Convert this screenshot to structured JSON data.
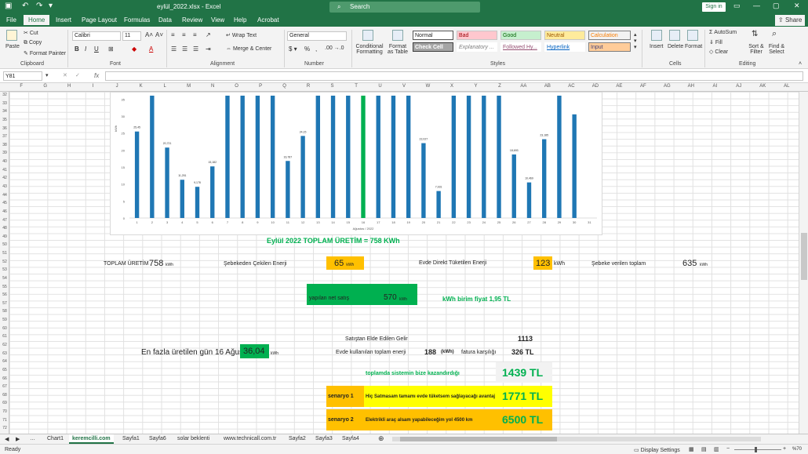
{
  "titlebar": {
    "file_name": "eylül_2022.xlsx",
    "sep": "-",
    "app": "Excel",
    "search": "Search",
    "signin": "Sign in"
  },
  "tabs": [
    "File",
    "Home",
    "Insert",
    "Page Layout",
    "Formulas",
    "Data",
    "Review",
    "View",
    "Help",
    "Acrobat"
  ],
  "share": "Share",
  "ribbon": {
    "clipboard": {
      "paste": "Paste",
      "cut": "Cut",
      "copy": "Copy",
      "format_painter": "Format Painter",
      "label": "Clipboard"
    },
    "font": {
      "name": "Calibri",
      "size": "11",
      "label": "Font"
    },
    "alignment": {
      "wrap": "Wrap Text",
      "merge": "Merge & Center",
      "label": "Alignment"
    },
    "number": {
      "format": "General",
      "label": "Number"
    },
    "styles": {
      "conditional": "Conditional Formatting",
      "format_table": "Format as Table",
      "normal": "Normal",
      "bad": "Bad",
      "good": "Good",
      "neutral": "Neutral",
      "calculation": "Calculation",
      "check_cell": "Check Cell",
      "explanatory": "Explanatory ...",
      "followed": "Followed Hy...",
      "hyperlink": "Hyperlink",
      "input": "Input",
      "label": "Styles"
    },
    "cells": {
      "insert": "Insert",
      "delete": "Delete",
      "format": "Format",
      "label": "Cells"
    },
    "editing": {
      "autosum": "AutoSum",
      "fill": "Fill",
      "clear": "Clear",
      "sort": "Sort & Filter",
      "find": "Find & Select",
      "label": "Editing"
    }
  },
  "namebox": "Y81",
  "fx": "fx",
  "columns": [
    "F",
    "G",
    "H",
    "I",
    "J",
    "K",
    "L",
    "M",
    "N",
    "O",
    "P",
    "Q",
    "R",
    "S",
    "T",
    "U",
    "V",
    "W",
    "X",
    "Y",
    "Z",
    "AA",
    "AB",
    "AC",
    "AD",
    "AE",
    "AF",
    "AG",
    "AH",
    "AI",
    "AJ",
    "AK",
    "AL"
  ],
  "rows": [
    "32",
    "33",
    "34",
    "35",
    "36",
    "37",
    "38",
    "39",
    "40",
    "41",
    "42",
    "43",
    "44",
    "45",
    "46",
    "47",
    "48",
    "49",
    "50",
    "51",
    "52",
    "53",
    "54",
    "55",
    "56",
    "57",
    "58",
    "59",
    "60",
    "61",
    "62",
    "63",
    "64",
    "65",
    "66",
    "67",
    "68",
    "69",
    "70",
    "71",
    "72"
  ],
  "chart_data": {
    "type": "bar",
    "xlabel": "Ağustos / 2022",
    "ylabel": "kWh",
    "ylim": [
      0,
      36
    ],
    "yticks": [
      "0",
      "5",
      "10",
      "15",
      "20",
      "25",
      "30",
      "35"
    ],
    "categories": [
      "1",
      "2",
      "3",
      "4",
      "5",
      "6",
      "7",
      "8",
      "9",
      "10",
      "11",
      "12",
      "13",
      "14",
      "15",
      "16",
      "17",
      "18",
      "19",
      "20",
      "21",
      "22",
      "23",
      "24",
      "25",
      "26",
      "27",
      "28",
      "29",
      "30",
      "31"
    ],
    "values": [
      25.45,
      36,
      20.721,
      11.251,
      9.178,
      15.182,
      36,
      36,
      36,
      36,
      16.787,
      24.15,
      36,
      36,
      36,
      36.04,
      36,
      36,
      36,
      22.027,
      7.931,
      36,
      36,
      36,
      36,
      18.693,
      10.469,
      23.185,
      36,
      30.5,
      0
    ],
    "data_labels": [
      "25,45",
      "",
      "20,721",
      "11,251",
      "9,178",
      "15,182",
      "",
      "",
      "",
      "",
      "16,787",
      "24,15",
      "",
      "",
      "",
      "",
      "",
      "",
      "",
      "22,027",
      "7,931",
      "",
      "",
      "",
      "",
      "18,693",
      "10,469",
      "23,185",
      "",
      "",
      ""
    ],
    "highlight_index": 15,
    "bar_color": "#1f77b4",
    "highlight_color": "#00b050",
    "gap_color": "#4472c4"
  },
  "sheet": {
    "title": "Eylül 2022 TOPLAM ÜRETİM = 758 KWh",
    "toplam_label": "TOPLAM ÜRETİM",
    "toplam_val": "758",
    "unit_kwh": "kWh",
    "sebekeden_label": "Şebekeden Çekilen Enerji",
    "sebekeden_val": "65",
    "direkt_label": "Evde Direkt Tüketilen Enerji",
    "direkt_val": "123",
    "direkt_unit": "kWh",
    "verilen_label": "Şebeke verilen toplam",
    "verilen_val": "635",
    "netsatis_label": "yapılan net satış",
    "netsatis_val": "570",
    "birim_fiyat": "kWh birim fiyat 1,95 TL",
    "satis_gelir_label": "Satıştan Elde Edilen Gelir",
    "satis_gelir_val": "1113",
    "max_gun_label": "En fazla üretilen gün 16 Ağustos",
    "max_gun_val": "36,04",
    "evde_label": "Evde kullanılan toplam enerji",
    "evde_val": "188",
    "evde_unit": "(kWh)",
    "fatura_label": "fatura karşılığı",
    "fatura_val": "326 TL",
    "kazanc_label": "toplamda sistemin bize kazandırdığı",
    "kazanc_val": "1439 TL",
    "senaryo1_label": "senaryo 1",
    "senaryo1_text": "Hiç Satmasam tamamı evde tüketsem sağlayacağı avantaj",
    "senaryo1_val": "1771 TL",
    "senaryo2_label": "senaryo 2",
    "senaryo2_text": "Elektrikli araç alsam yapabileceğim yol  4500 km",
    "senaryo2_val": "6500 TL"
  },
  "sheet_tabs": [
    "Chart1",
    "keremcilli.com",
    "Sayfa1",
    "Sayfa6",
    "solar beklenti",
    "www.technicall.com.tr",
    "Sayfa2",
    "Sayfa3",
    "Sayfa4"
  ],
  "active_sheet": "keremcilli.com",
  "status": {
    "ready": "Ready",
    "display": "Display Settings",
    "zoom": "%70"
  }
}
